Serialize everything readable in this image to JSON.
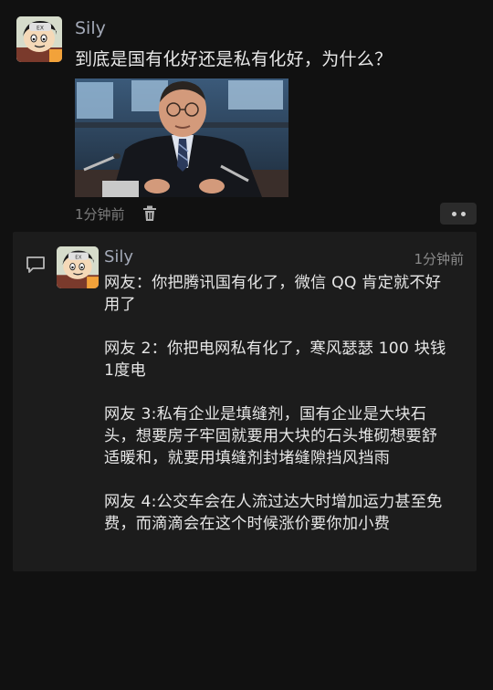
{
  "post": {
    "author": "Sily",
    "text": "到底是国有化好还是私有化好，为什么？",
    "time": "1分钟前",
    "avatar_icon": "cartoon-boy-avatar",
    "photo_icon": "man-in-suit-photo",
    "delete_icon": "trash-icon",
    "more_icon": "more-dots-icon"
  },
  "comment": {
    "icon": "comment-bubble-icon",
    "author": "Sily",
    "time": "1分钟前",
    "paragraphs": [
      "网友：你把腾讯国有化了，微信 QQ 肯定就不好用了",
      "网友 2：你把电网私有化了，寒风瑟瑟 100 块钱 1度电",
      "网友 3:私有企业是填缝剂，国有企业是大块石头，想要房子牢固就要用大块的石头堆砌想要舒适暖和，就要用填缝剂封堵缝隙挡风挡雨",
      "网友 4:公交车会在人流过达大时增加运力甚至免费，而滴滴会在这个时候涨价要你加小费"
    ]
  },
  "colors": {
    "background": "#111111",
    "panel": "#1c1c1c",
    "name": "#a3a9b7",
    "text": "#e6e6e6",
    "muted": "#7c7c7c"
  }
}
